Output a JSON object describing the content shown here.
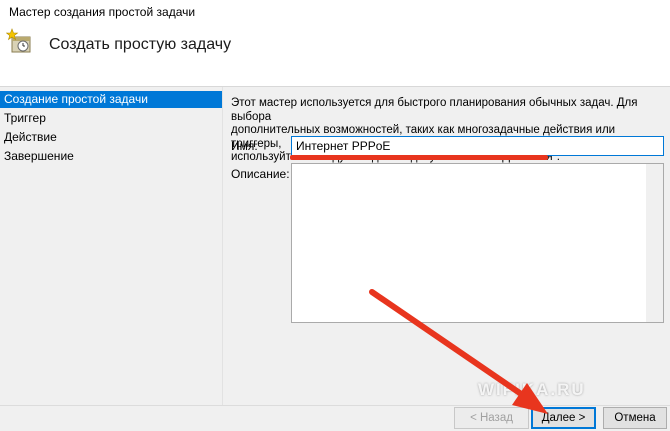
{
  "window": {
    "title": "Мастер создания простой задачи"
  },
  "header": {
    "heading": "Создать простую задачу",
    "icon": "task-wizard-icon"
  },
  "sidebar": {
    "items": [
      {
        "label": "Создание простой задачи",
        "active": true
      },
      {
        "label": "Триггер",
        "active": false
      },
      {
        "label": "Действие",
        "active": false
      },
      {
        "label": "Завершение",
        "active": false
      }
    ]
  },
  "main": {
    "description_lines": [
      "Этот мастер используется для быстрого планирования обычных задач.  Для выбора",
      "дополнительных возможностей, таких как многозадачные действия или триггеры,",
      "используйте команду \"Создать задачу\" в области \"Действия\"."
    ],
    "name_label": "Имя:",
    "name_value": "Интернет PPPoE",
    "description_label": "Описание:",
    "description_value": ""
  },
  "buttons": {
    "back": "< Назад",
    "next": "Далее >",
    "cancel": "Отмена"
  },
  "watermark": "WIFIKA.RU",
  "colors": {
    "accent": "#0078d7",
    "annotation": "#e8351e"
  }
}
